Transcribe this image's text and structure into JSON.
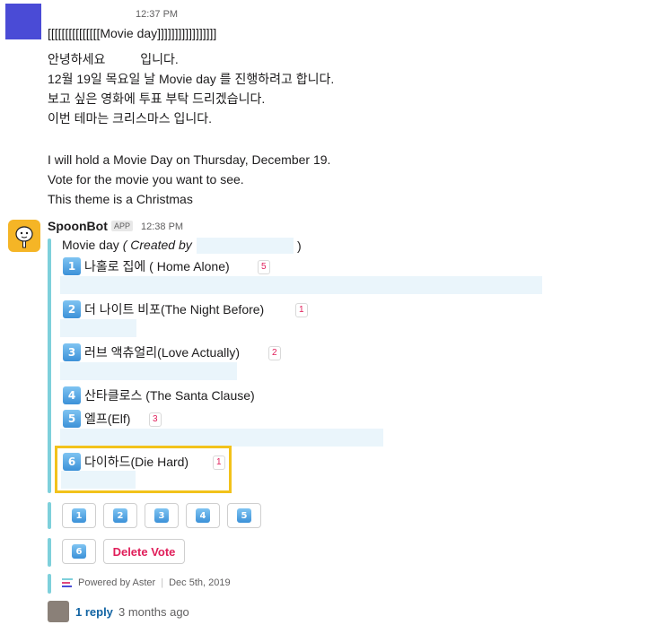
{
  "message1": {
    "time": "12:37 PM",
    "lines": [
      "[[[[[[[[[[[[[[[Movie day]]]]]]]]]]]]]]]]]",
      "안녕하세요          입니다.",
      "12월 19일 목요일 날 Movie day 를 진행하려고 합니다.",
      "보고 싶은 영화에 투표 부탁 드리겠습니다.",
      "이번 테마는 크리스마스 입니다.",
      "I will hold a Movie Day on Thursday, December 19.",
      "Vote for the movie you want to see.",
      "This theme is a Christmas"
    ]
  },
  "bot": {
    "name": "SpoonBot",
    "badge": "APP",
    "time": "12:38 PM",
    "poll_title": "Movie day",
    "created_by": "( Created by",
    "close_paren": ")",
    "options": [
      {
        "num": "1",
        "label": "나홀로 집에 ( Home Alone)",
        "count": "5"
      },
      {
        "num": "2",
        "label": "더 나이트 비포(The Night Before)",
        "count": "1"
      },
      {
        "num": "3",
        "label": "러브 액츄얼리(Love Actually)",
        "count": "2"
      },
      {
        "num": "4",
        "label": "산타클로스 (The Santa Clause)",
        "count": ""
      },
      {
        "num": "5",
        "label": "엘프(Elf)",
        "count": "3"
      },
      {
        "num": "6",
        "label": "다이하드(Die Hard)",
        "count": "1"
      }
    ],
    "vote_buttons": [
      "1",
      "2",
      "3",
      "4",
      "5",
      "6"
    ],
    "delete_label": "Delete Vote",
    "powered_by": "Powered by Aster",
    "date": "Dec 5th, 2019",
    "reply": "1 reply",
    "reply_time": "3 months ago"
  },
  "colors": {
    "accent_bar": "#7ed0db",
    "highlight": "#f2c21b",
    "count": "#e01e5a",
    "link": "#1264a3"
  }
}
